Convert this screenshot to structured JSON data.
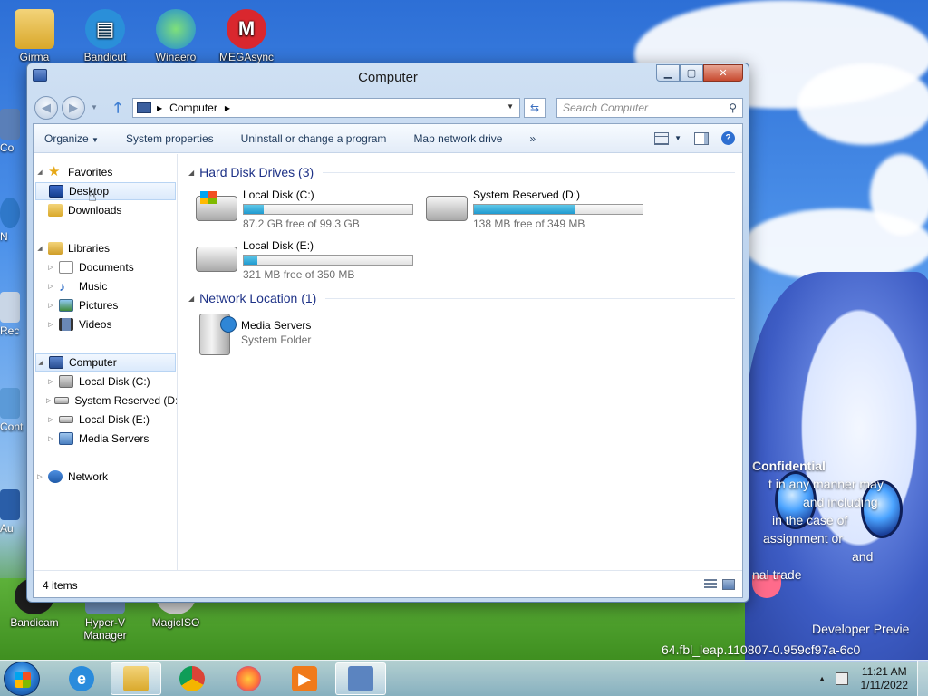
{
  "desktop": {
    "top_icons": [
      {
        "label": "Girma"
      },
      {
        "label": "Bandicut"
      },
      {
        "label": "Winaero"
      },
      {
        "label": "MEGAsync"
      }
    ],
    "left_edge_icons": [
      {
        "label": "Co"
      },
      {
        "label": "N"
      },
      {
        "label": "Rec"
      },
      {
        "label": "Cont"
      },
      {
        "label": "Au"
      }
    ],
    "bottom_icons": [
      {
        "label": "Bandicam"
      },
      {
        "label": "Hyper-V Manager"
      },
      {
        "label": "MagicISO"
      }
    ],
    "watermark_lines": [
      "Confidential",
      "t in any manner may",
      "and including",
      "in the case of",
      "assignment or",
      "and",
      "nal trade"
    ],
    "build_text_1": "Developer Previe",
    "build_text_2": "64.fbl_leap.110807-0.959cf97a-6c0"
  },
  "window": {
    "title": "Computer",
    "address": {
      "segments": [
        "Computer"
      ]
    },
    "search_placeholder": "Search Computer",
    "toolbar": {
      "organize": "Organize",
      "system_properties": "System properties",
      "uninstall": "Uninstall or change a program",
      "map_drive": "Map network drive",
      "more": "»"
    },
    "nav": {
      "favorites": "Favorites",
      "desktop": "Desktop",
      "downloads": "Downloads",
      "libraries": "Libraries",
      "documents": "Documents",
      "music": "Music",
      "pictures": "Pictures",
      "videos": "Videos",
      "computer": "Computer",
      "local_c": "Local Disk (C:)",
      "system_reserved": "System Reserved (D:",
      "local_e": "Local Disk (E:)",
      "media_servers": "Media Servers",
      "network": "Network"
    },
    "groups": {
      "hdd": "Hard Disk Drives (3)",
      "network": "Network Location (1)"
    },
    "drives": [
      {
        "name": "Local Disk (C:)",
        "free_text": "87.2 GB free of 99.3 GB",
        "used_fraction": 0.12
      },
      {
        "name": "System Reserved (D:)",
        "free_text": "138 MB free of 349 MB",
        "used_fraction": 0.6
      },
      {
        "name": "Local Disk (E:)",
        "free_text": "321 MB free of 350 MB",
        "used_fraction": 0.08
      }
    ],
    "network_item": {
      "name": "Media Servers",
      "type": "System Folder"
    },
    "status": {
      "count": "4 items"
    }
  },
  "taskbar": {
    "clock_time": "11:21 AM",
    "clock_date": "1/11/2022",
    "apps": [
      "Internet Explorer",
      "Windows Explorer",
      "Chrome",
      "Firefox",
      "Media Player",
      "Hyper-V"
    ]
  },
  "colors": {
    "accent": "#1e3287",
    "progress": "#1f9ad0",
    "selection": "#dbeafc"
  }
}
